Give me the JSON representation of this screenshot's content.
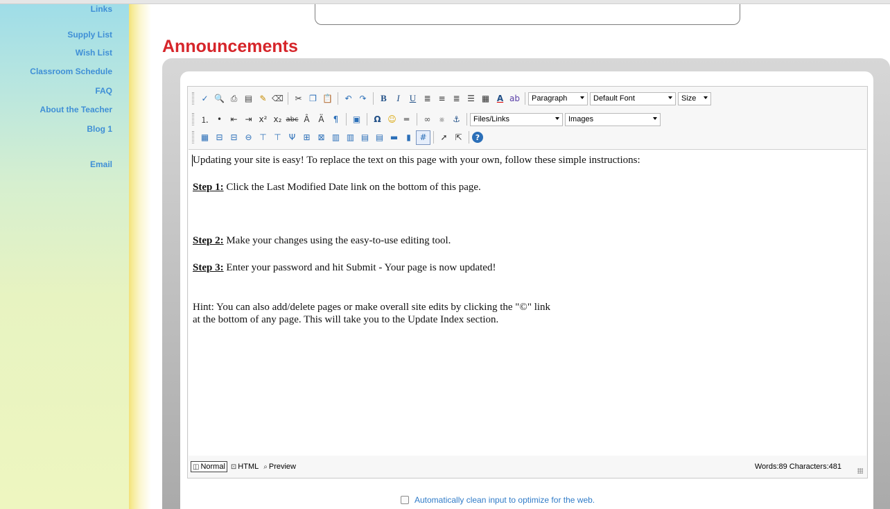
{
  "sidebar": {
    "items": [
      {
        "label": "Links"
      },
      {
        "label": "Supply List"
      },
      {
        "label": "Wish List"
      },
      {
        "label": "Classroom Schedule"
      },
      {
        "label": "FAQ"
      },
      {
        "label": "About the Teacher"
      },
      {
        "label": "Blog 1"
      },
      {
        "label": "Email"
      }
    ]
  },
  "page": {
    "title": "Announcements"
  },
  "toolbar": {
    "format_select": "Paragraph",
    "font_select": "Default Font",
    "size_select": "Size",
    "files_select": "Files/Links",
    "images_select": "Images"
  },
  "editor": {
    "intro": "Updating your site is easy! To replace the text on this page with your own, follow these simple instructions:",
    "step1_label": "Step 1:",
    "step1_text": " Click the Last Modified Date link on the bottom of this page.",
    "step2_label": "Step 2:",
    "step2_text": " Make your changes using the easy-to-use editing tool.",
    "step3_label": "Step 3:",
    "step3_text": " Enter your password and hit Submit - Your page is now updated!",
    "hint_line1": "Hint: You can also add/delete pages or make overall site edits by clicking the \"©\" link",
    "hint_line2": "at the bottom of any page. This will take you to the Update Index section."
  },
  "statusbar": {
    "normal_label": "Normal",
    "html_label": "HTML",
    "preview_label": "Preview",
    "counts": "Words:89 Characters:481"
  },
  "options": {
    "clean_input_label": "Automatically clean input to optimize for the web."
  },
  "colors": {
    "title": "#d6252a",
    "nav": "#3f8fd6",
    "link": "#2f7bc8"
  }
}
